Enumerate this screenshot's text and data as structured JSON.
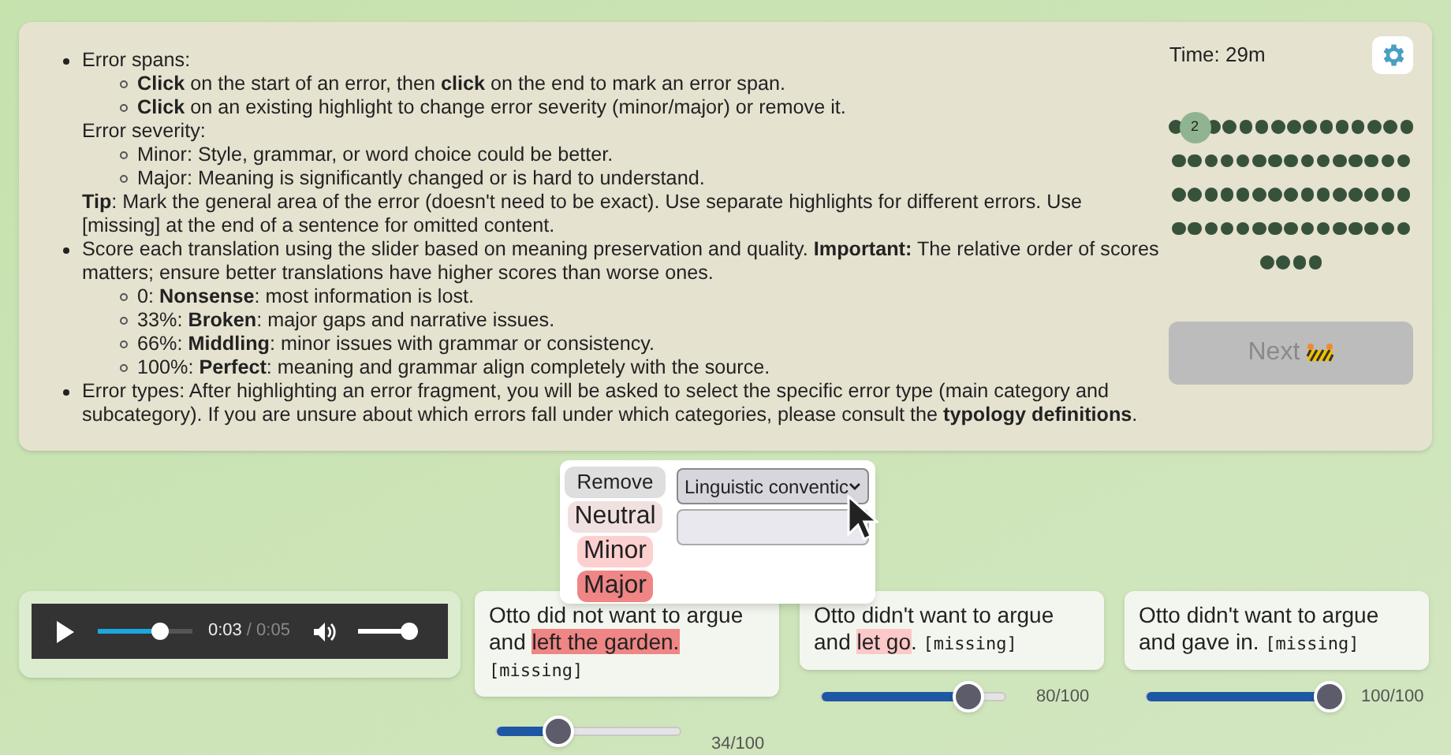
{
  "instructions": [
    {
      "parts": [
        {
          "kind": "text",
          "text": "Error spans:"
        },
        {
          "kind": "sublist",
          "items": [
            "**Click** on the start of an error, then **click** on the end to mark an error span.",
            "**Click** on an existing highlight to change error severity (minor/major) or remove it."
          ]
        },
        {
          "kind": "text",
          "text": "Error severity:"
        },
        {
          "kind": "sublist",
          "items": [
            "Minor: Style, grammar, or word choice could be better.",
            "Major: Meaning is significantly changed or is hard to understand."
          ]
        },
        {
          "kind": "text",
          "text": "**Tip**: Mark the general area of the error (doesn't need to be exact). Use separate highlights for different errors. Use [missing] at the end of a sentence for omitted content."
        }
      ]
    },
    {
      "parts": [
        {
          "kind": "text",
          "text": "Score each translation using the slider based on meaning preservation and quality. **Important:** The relative order of scores matters; ensure better translations have higher scores than worse ones."
        },
        {
          "kind": "sublist",
          "items": [
            "0: **Nonsense**: most information is lost.",
            "33%: **Broken**: major gaps and narrative issues.",
            "66%: **Middling**: minor issues with grammar or consistency.",
            "100%: **Perfect**: meaning and grammar align completely with the source."
          ]
        }
      ]
    },
    {
      "parts": [
        {
          "kind": "text",
          "text": "Error types: After highlighting an error fragment, you will be asked to select the specific error type (main category and subcategory). If you are unsure about which errors fall under which categories, please consult the **typology definitions**."
        }
      ]
    }
  ],
  "timer": "Time: 29m",
  "progress": {
    "rows": [
      [
        {
          "selected": false
        },
        {
          "selected": true,
          "label": "2"
        },
        {
          "selected": false
        },
        {
          "selected": false
        },
        {
          "selected": false
        },
        {
          "selected": false
        },
        {
          "selected": false
        },
        {
          "selected": false
        },
        {
          "selected": false
        },
        {
          "selected": false
        },
        {
          "selected": false
        },
        {
          "selected": false
        },
        {
          "selected": false
        },
        {
          "selected": false
        },
        {
          "selected": false
        }
      ],
      [
        {
          "selected": false
        },
        {
          "selected": false
        },
        {
          "selected": false
        },
        {
          "selected": false
        },
        {
          "selected": false
        },
        {
          "selected": false
        },
        {
          "selected": false
        },
        {
          "selected": false
        },
        {
          "selected": false
        },
        {
          "selected": false
        },
        {
          "selected": false
        },
        {
          "selected": false
        },
        {
          "selected": false
        },
        {
          "selected": false
        },
        {
          "selected": false
        }
      ],
      [
        {
          "selected": false
        },
        {
          "selected": false
        },
        {
          "selected": false
        },
        {
          "selected": false
        },
        {
          "selected": false
        },
        {
          "selected": false
        },
        {
          "selected": false
        },
        {
          "selected": false
        },
        {
          "selected": false
        },
        {
          "selected": false
        },
        {
          "selected": false
        },
        {
          "selected": false
        },
        {
          "selected": false
        },
        {
          "selected": false
        },
        {
          "selected": false
        }
      ],
      [
        {
          "selected": false
        },
        {
          "selected": false
        },
        {
          "selected": false
        },
        {
          "selected": false
        },
        {
          "selected": false
        },
        {
          "selected": false
        },
        {
          "selected": false
        },
        {
          "selected": false
        },
        {
          "selected": false
        },
        {
          "selected": false
        },
        {
          "selected": false
        },
        {
          "selected": false
        },
        {
          "selected": false
        },
        {
          "selected": false
        },
        {
          "selected": false
        }
      ],
      [
        {
          "selected": false
        },
        {
          "selected": false
        },
        {
          "selected": false
        },
        {
          "selected": false
        }
      ]
    ]
  },
  "next_button": {
    "label": "Next",
    "disabled": true
  },
  "audio": {
    "current": "0:03",
    "duration": "/ 0:05",
    "level": 0.65,
    "volume": {
      "level": 1
    }
  },
  "popup": {
    "severities": [
      {
        "label": "Remove",
        "kind": "remove"
      },
      {
        "label": "Neutral",
        "kind": "neutral"
      },
      {
        "label": "Minor",
        "kind": "minor"
      },
      {
        "label": "Major",
        "kind": "major"
      }
    ],
    "category": {
      "value": "Linguistic conventic"
    }
  },
  "translations": [
    {
      "segments": [
        {
          "text": "Otto did not want to argue and ",
          "kind": "plain"
        },
        {
          "text": "left the garden.",
          "kind": "major"
        },
        {
          "text": "[missing]",
          "kind": "missing"
        }
      ],
      "level": 0.34,
      "score": "34/100"
    },
    {
      "segments": [
        {
          "text": "Otto didn't want to argue and ",
          "kind": "plain"
        },
        {
          "text": "let go",
          "kind": "minor"
        },
        {
          "text": ". ",
          "kind": "plain"
        },
        {
          "text": "[missing]",
          "kind": "missing"
        }
      ],
      "level": 0.8,
      "score": "80/100"
    },
    {
      "segments": [
        {
          "text": "Otto didn't want to argue and gave in. ",
          "kind": "plain"
        },
        {
          "text": "[missing]",
          "kind": "missing"
        }
      ],
      "level": 1,
      "score": "100/100"
    }
  ]
}
